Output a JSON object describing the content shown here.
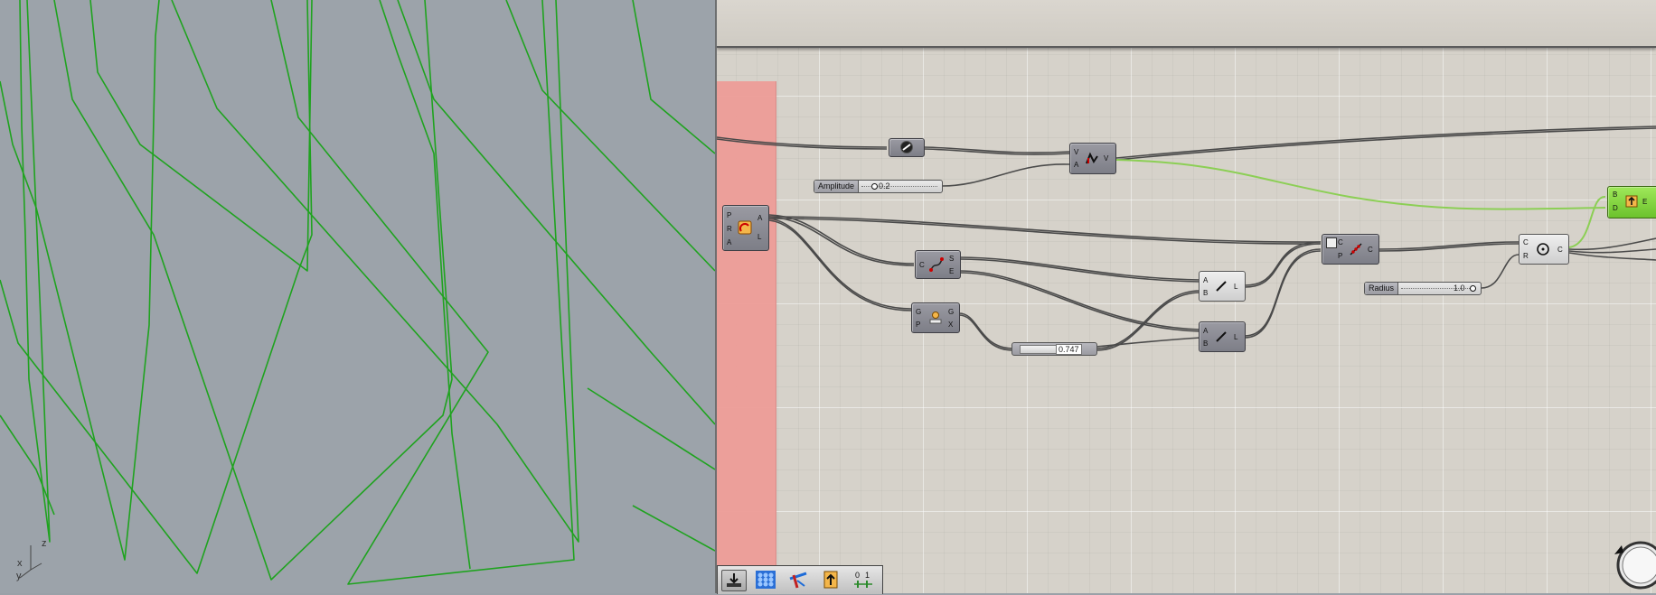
{
  "viewport": {
    "background": "#9ca3aa",
    "curve_color": "#1fa31f",
    "axis_labels": {
      "z": "z",
      "x": "x",
      "y": "y"
    }
  },
  "canvas": {
    "background": "#d6d2ca",
    "group_color": "#ee9d98",
    "wire_color": "#4a4a4a",
    "highlight_wire_color": "#8ccf55"
  },
  "components": {
    "arc": {
      "inputs": [
        "P",
        "R",
        "A"
      ],
      "outputs": [
        "A",
        "L"
      ],
      "icon": "arc-icon"
    },
    "curve_end_points": {
      "inputs": [
        "C"
      ],
      "outputs": [
        "S",
        "E"
      ],
      "icon": "curve-endpoints-icon"
    },
    "deconstruct": {
      "inputs": [
        "G",
        "P"
      ],
      "outputs": [
        "G",
        "X"
      ],
      "icon": "deconstruct-icon"
    },
    "amplitude_vector": {
      "inputs": [
        "V",
        "A"
      ],
      "outputs": [
        "V"
      ],
      "icon": "amplitude-icon"
    },
    "line_1": {
      "inputs": [
        "A",
        "B"
      ],
      "outputs": [
        "L"
      ],
      "icon": "line-icon"
    },
    "line_2": {
      "inputs": [
        "A",
        "B"
      ],
      "outputs": [
        "L"
      ],
      "icon": "line-icon"
    },
    "divide_curve": {
      "inputs": [
        "C",
        "P"
      ],
      "outputs": [
        "C"
      ],
      "icon": "divide-curve-icon"
    },
    "circle": {
      "inputs": [
        "C",
        "R"
      ],
      "outputs": [
        "C"
      ],
      "icon": "circle-icon"
    },
    "extrude": {
      "inputs": [
        "B",
        "D"
      ],
      "outputs": [
        "E"
      ],
      "icon": "extrude-icon"
    },
    "unit_vector": {
      "icon": "unit-vector-icon"
    }
  },
  "sliders": {
    "amplitude": {
      "label": "Amplitude",
      "value": "0.2"
    },
    "radius": {
      "label": "Radius",
      "value": "1.0"
    },
    "param": {
      "value": "0.747"
    }
  },
  "toolbar": {
    "icons": [
      "bake-icon",
      "mesh-icon",
      "graph-icon",
      "extrude-icon",
      "numbers-icon"
    ]
  }
}
